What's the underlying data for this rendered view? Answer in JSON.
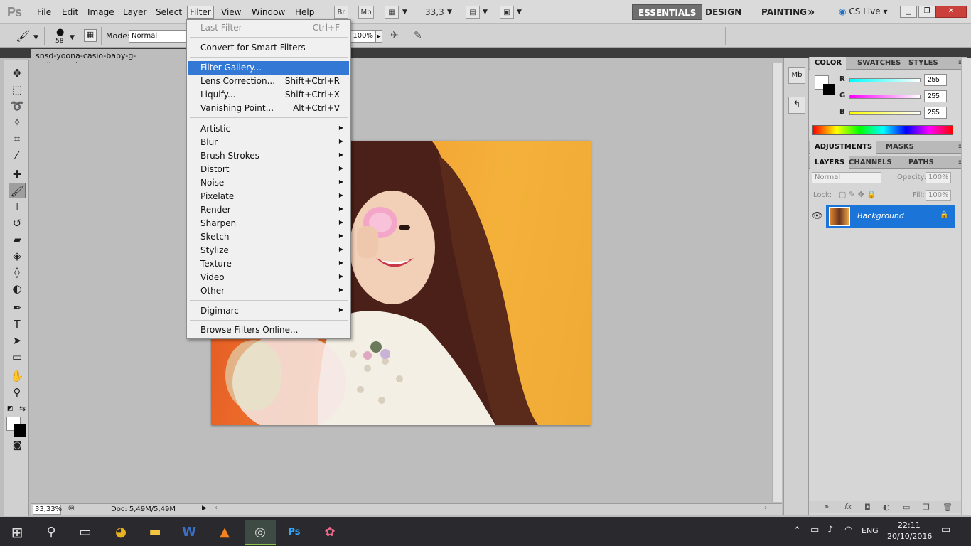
{
  "app": {
    "logo": "Ps",
    "menu": [
      "File",
      "Edit",
      "Image",
      "Layer",
      "Select",
      "Filter",
      "View",
      "Window",
      "Help"
    ],
    "bridge_label": "Br",
    "minibridge_label": "Mb",
    "zoom_value": "33,3",
    "workspaces": [
      "ESSENTIALS",
      "DESIGN",
      "PAINTING"
    ],
    "more_workspaces": "»",
    "cs_live": "CS Live"
  },
  "options": {
    "brush_size": "58",
    "mode_label": "Mode:",
    "mode_value": "Normal",
    "opacity_value": "100%"
  },
  "document": {
    "tab_title": "snsd-yoona-casio-baby-g-wallpaper.jpg",
    "zoom_status": "33,33%",
    "doc_info": "Doc: 5,49M/5,49M"
  },
  "filter_menu": {
    "last_filter": {
      "label": "Last Filter",
      "shortcut": "Ctrl+F"
    },
    "convert": "Convert for Smart Filters",
    "gallery": "Filter Gallery...",
    "lens": {
      "label": "Lens Correction...",
      "shortcut": "Shift+Ctrl+R"
    },
    "liquify": {
      "label": "Liquify...",
      "shortcut": "Shift+Ctrl+X"
    },
    "vanishing": {
      "label": "Vanishing Point...",
      "shortcut": "Alt+Ctrl+V"
    },
    "submenus": [
      "Artistic",
      "Blur",
      "Brush Strokes",
      "Distort",
      "Noise",
      "Pixelate",
      "Render",
      "Sharpen",
      "Sketch",
      "Stylize",
      "Texture",
      "Video",
      "Other"
    ],
    "digimarc": "Digimarc",
    "browse": "Browse Filters Online..."
  },
  "color_panel": {
    "tabs": [
      "COLOR",
      "SWATCHES",
      "STYLES"
    ],
    "r_label": "R",
    "r_value": "255",
    "g_label": "G",
    "g_value": "255",
    "b_label": "B",
    "b_value": "255"
  },
  "adjust_panel": {
    "tabs": [
      "ADJUSTMENTS",
      "MASKS"
    ]
  },
  "layers_panel": {
    "tabs": [
      "LAYERS",
      "CHANNELS",
      "PATHS"
    ],
    "blend_mode": "Normal",
    "opacity_label": "Opacity:",
    "opacity_value": "100%",
    "lock_label": "Lock:",
    "fill_label": "Fill:",
    "fill_value": "100%",
    "layer_name": "Background"
  },
  "taskbar": {
    "lang": "ENG",
    "time": "22:11",
    "date": "20/10/2016"
  }
}
